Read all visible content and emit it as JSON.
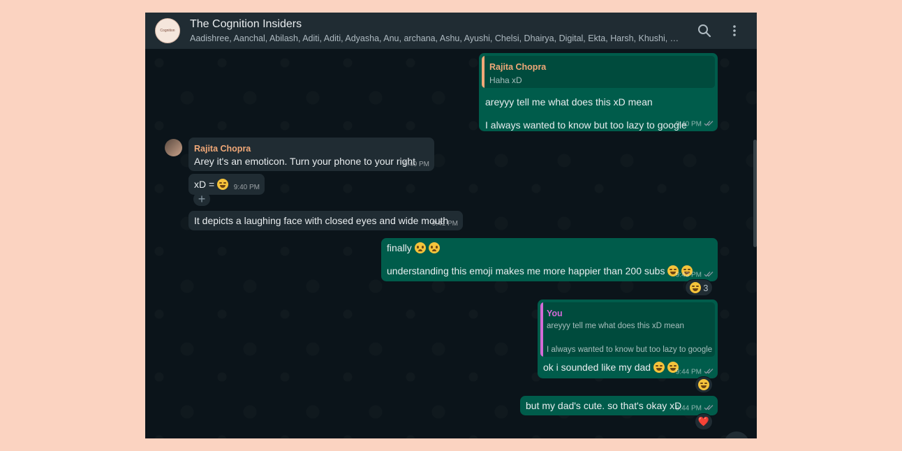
{
  "header": {
    "avatar_text": "Cognition",
    "group_name": "The Cognition Insiders",
    "members": "Aadishree, Aanchal, Abilash, Aditi, Aditi, Adyasha, Anu, archana, Ashu, Ayushi, Chelsi, Dhairya, Digital, Ekta, Harsh, Khushi, Krisha, K..."
  },
  "icons": {
    "search": "search-icon",
    "menu": "more-vertical-icon",
    "scroll_down": "chevron-down-icon"
  },
  "messages": {
    "m1": {
      "quote_name": "Rajita Chopra",
      "quote_text": "Haha xD",
      "line1": "areyyy tell me what does this xD mean",
      "line2": "I always wanted to know but too lazy to google",
      "time": "9:40 PM"
    },
    "m2": {
      "sender": "Rajita Chopra",
      "text": "Arey it's an emoticon. Turn your phone to your right",
      "time": "9:40 PM"
    },
    "m3": {
      "text": "xD =",
      "time": "9:40 PM"
    },
    "m4": {
      "text": "It depicts a laughing face with closed eyes and wide mouth",
      "time": "9:41 PM"
    },
    "m5": {
      "line1": "finally",
      "line2": "understanding this emoji makes me more happier than 200 subs",
      "time": "9:43 PM",
      "reaction_count": "3"
    },
    "m6": {
      "quote_name": "You",
      "quote_line1": "areyyy tell me what does this xD mean",
      "quote_line2": "I always wanted to know but too lazy to google",
      "text": "ok i sounded like my dad",
      "time": "9:44 PM"
    },
    "m7": {
      "text": "but my dad's cute. so that's okay xD",
      "time": "9:44 PM",
      "reaction": "❤️"
    }
  },
  "colors": {
    "outgoing": "#005c4b",
    "incoming": "#202c33",
    "sender_name": "#f0a878",
    "quote_you": "#d36ad6",
    "quote_rajita": "#f0a878",
    "read_ticks": "#8696a0"
  }
}
